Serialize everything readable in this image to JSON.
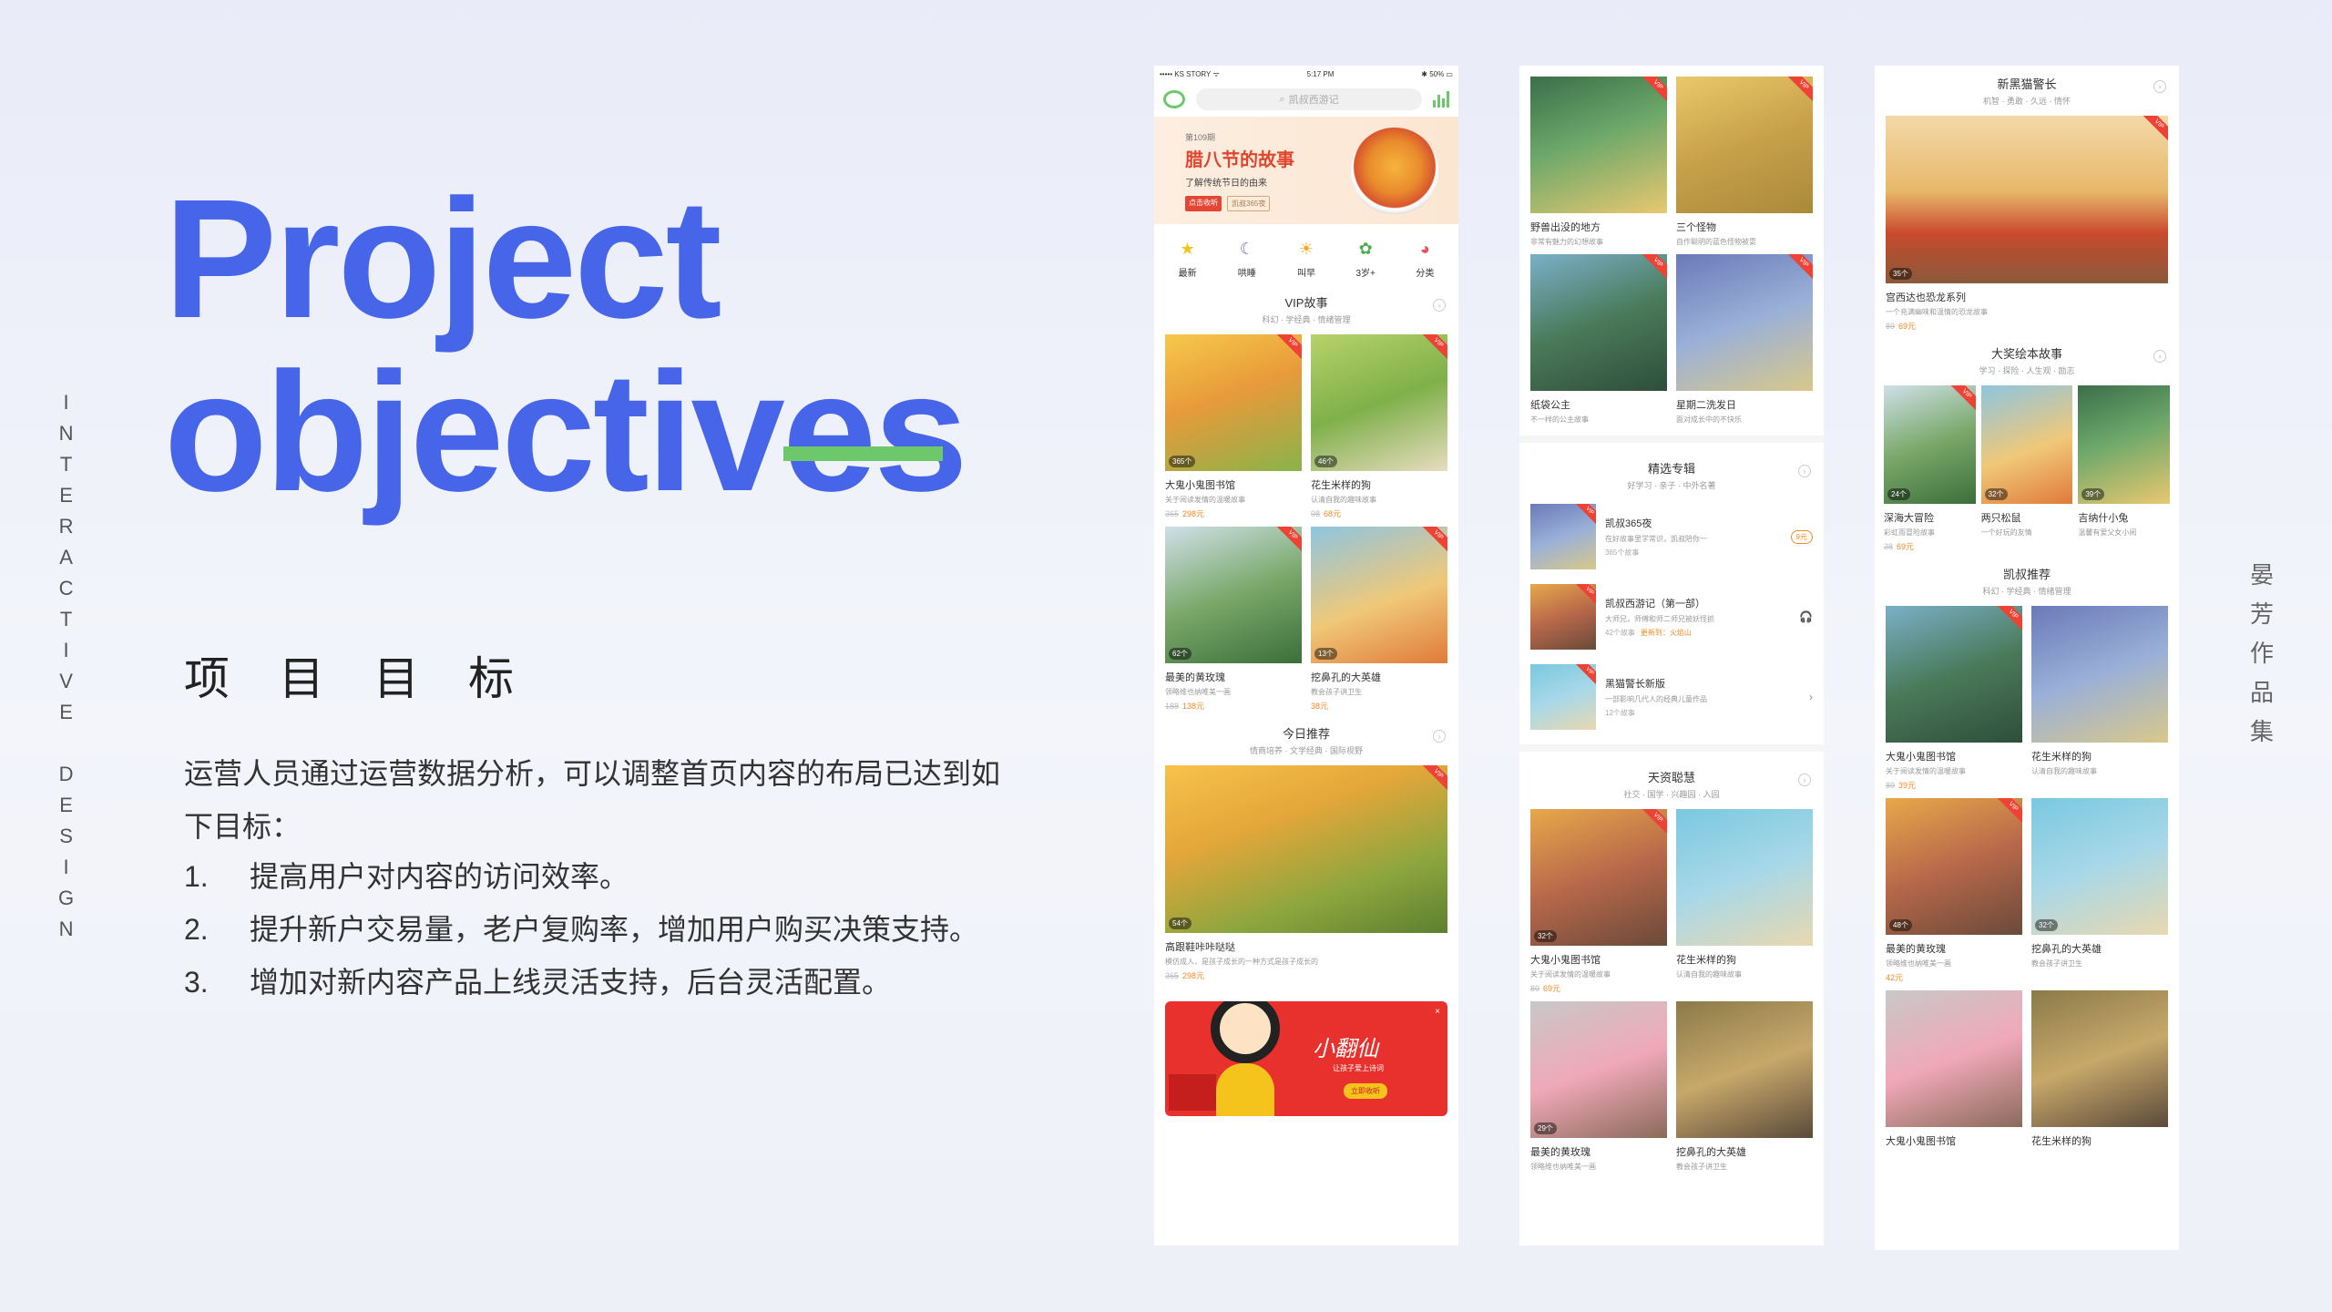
{
  "side_left": [
    "I",
    "N",
    "T",
    "E",
    "R",
    "A",
    "C",
    "T",
    "I",
    "V",
    "E",
    "",
    "D",
    "E",
    "S",
    "I",
    "G",
    "N"
  ],
  "side_right": [
    "晏",
    "芳",
    "作",
    "品",
    "集"
  ],
  "title_line1": "Project",
  "title_line2": "objectives",
  "subtitle": "项目目标",
  "desc": "运营人员通过运营数据分析，可以调整首页内容的布局已达到如下目标：",
  "goals": [
    {
      "num": "1.",
      "text": "提高用户对内容的访问效率。"
    },
    {
      "num": "2.",
      "text": "提升新户交易量，老户复购率，增加用户购买决策支持。"
    },
    {
      "num": "3.",
      "text": "增加对新内容产品上线灵活支持，后台灵活配置。"
    }
  ],
  "colors": {
    "accent": "#4765e8",
    "bar": "#6cc86b",
    "vip": "#ed4234",
    "price": "#f08a24"
  },
  "phone": {
    "status": {
      "carrier": "••••• KS STORY ᯤ",
      "time": "5:17 PM",
      "battery": "✱ 50% ▭"
    },
    "search_placeholder": "凯叔西游记",
    "banner": {
      "issue": "第109期",
      "title": "腊八节的故事",
      "sub": "了解传统节日的由来",
      "tag1": "点击收听",
      "tag2": "凯叔365夜"
    },
    "categories": [
      {
        "label": "最新",
        "icon": "★",
        "color": "#f5c41c"
      },
      {
        "label": "哄睡",
        "icon": "☾",
        "color": "#7d6bbd"
      },
      {
        "label": "叫早",
        "icon": "☀",
        "color": "#f5a623"
      },
      {
        "label": "3岁+",
        "icon": "✿",
        "color": "#4caf50"
      },
      {
        "label": "分类",
        "icon": "◕",
        "color": "#e8525b"
      }
    ],
    "vip": {
      "title": "VIP故事",
      "sub": "科幻 · 学经典 · 情绪管理",
      "items": [
        {
          "name": "大鬼小鬼图书馆",
          "desc": "关于阅读发情的温暖故事",
          "old": "365",
          "price": "298元",
          "count": "365个"
        },
        {
          "name": "花生米样的狗",
          "desc": "认清自我的趣味故事",
          "old": "98",
          "price": "68元",
          "count": "46个"
        },
        {
          "name": "最美的黄玫瑰",
          "desc": "领略维也纳唯美一画",
          "old": "188",
          "price": "138元",
          "count": "62个"
        },
        {
          "name": "挖鼻孔的大英雄",
          "desc": "教会孩子讲卫生",
          "old": "",
          "price": "38元",
          "count": "13个"
        }
      ]
    },
    "today": {
      "title": "今日推荐",
      "sub": "情商培养 · 文学经典 · 国际视野",
      "name": "高跟鞋咔咔哒哒",
      "desc": "模仿成人，是孩子成长的一种方式是孩子成长的",
      "old": "365",
      "price": "298元",
      "count": "54个"
    },
    "ad": {
      "title": "小翻仙",
      "sub": "让孩子爱上诗词",
      "btn": "立即收听",
      "close": "×"
    }
  },
  "column_b": {
    "top": [
      {
        "name": "野兽出没的地方",
        "desc": "非常有魅力的幻想故事"
      },
      {
        "name": "三个怪物",
        "desc": "自作聪明的蓝色怪物被耍"
      },
      {
        "name": "纸袋公主",
        "desc": "不一样的公主故事"
      },
      {
        "name": "星期二洗发日",
        "desc": "面对成长中的不快乐"
      }
    ],
    "featured": {
      "title": "精选专辑",
      "sub": "好学习 · 亲子 · 中外名著",
      "items": [
        {
          "name": "凯叔365夜",
          "desc": "在好故事里学常识，凯叔陪你一",
          "meta": "365个故事",
          "extra": "",
          "btn": "9元"
        },
        {
          "name": "凯叔西游记（第一部）",
          "desc": "大师兄，师傅和师二师兄被妖怪抓",
          "meta": "42个故事",
          "extra": "更新到：火焰山",
          "btn": "🎧"
        },
        {
          "name": "黑猫警长新版",
          "desc": "一部影响几代人的经典儿童作品",
          "meta": "12个故事",
          "extra": "",
          "btn": "›"
        }
      ]
    },
    "wisdom": {
      "title": "天资聪慧",
      "sub": "社交 · 国学 · 兴趣园 · 入园",
      "items": [
        {
          "name": "大鬼小鬼图书馆",
          "desc": "关于阅读发情的温暖故事",
          "old": "89",
          "price": "69元",
          "count": "32个"
        },
        {
          "name": "花生米样的狗",
          "desc": "认清自我的趣味故事",
          "old": "",
          "price": "",
          "count": ""
        },
        {
          "name": "最美的黄玫瑰",
          "desc": "领略维也纳唯美一画",
          "old": "",
          "price": "",
          "count": "29个"
        },
        {
          "name": "挖鼻孔的大英雄",
          "desc": "教会孩子讲卫生",
          "old": "",
          "price": "",
          "count": ""
        }
      ]
    }
  },
  "column_c": {
    "police": {
      "title": "新黑猫警长",
      "sub": "机智 · 勇敢 · 久远 · 情怀",
      "name": "宫西达也恐龙系列",
      "desc": "一个充满幽味和温情的恐龙故事",
      "old": "89",
      "price": "69元",
      "count": "35个"
    },
    "award": {
      "title": "大奖绘本故事",
      "sub": "学习 · 探险 · 人生观 · 励志",
      "items": [
        {
          "name": "深海大冒险",
          "desc": "彩虹雨冒险故事",
          "old": "38",
          "price": "69元",
          "count": "24个"
        },
        {
          "name": "两只松鼠",
          "desc": "一个好玩的友情",
          "old": "",
          "price": "",
          "count": "32个"
        },
        {
          "name": "吉纳什小兔",
          "desc": "温馨有爱父女小阅",
          "old": "",
          "price": "",
          "count": "39个"
        }
      ]
    },
    "kai": {
      "title": "凯叔推荐",
      "sub": "科幻 · 学经典 · 情绪管理",
      "items": [
        {
          "name": "大鬼小鬼图书馆",
          "desc": "关于阅读发情的温暖故事",
          "old": "89",
          "price": "39元",
          "count": ""
        },
        {
          "name": "花生米样的狗",
          "desc": "认清自我的趣味故事",
          "old": "",
          "price": "",
          "count": ""
        },
        {
          "name": "最美的黄玫瑰",
          "desc": "领略维也纳唯美一画",
          "old": "",
          "price": "42元",
          "count": "48个"
        },
        {
          "name": "挖鼻孔的大英雄",
          "desc": "教会孩子讲卫生",
          "old": "",
          "price": "",
          "count": "32个"
        },
        {
          "name": "大鬼小鬼图书馆",
          "desc": "",
          "old": "",
          "price": "",
          "count": ""
        },
        {
          "name": "花生米样的狗",
          "desc": "",
          "old": "",
          "price": "",
          "count": ""
        }
      ]
    }
  }
}
